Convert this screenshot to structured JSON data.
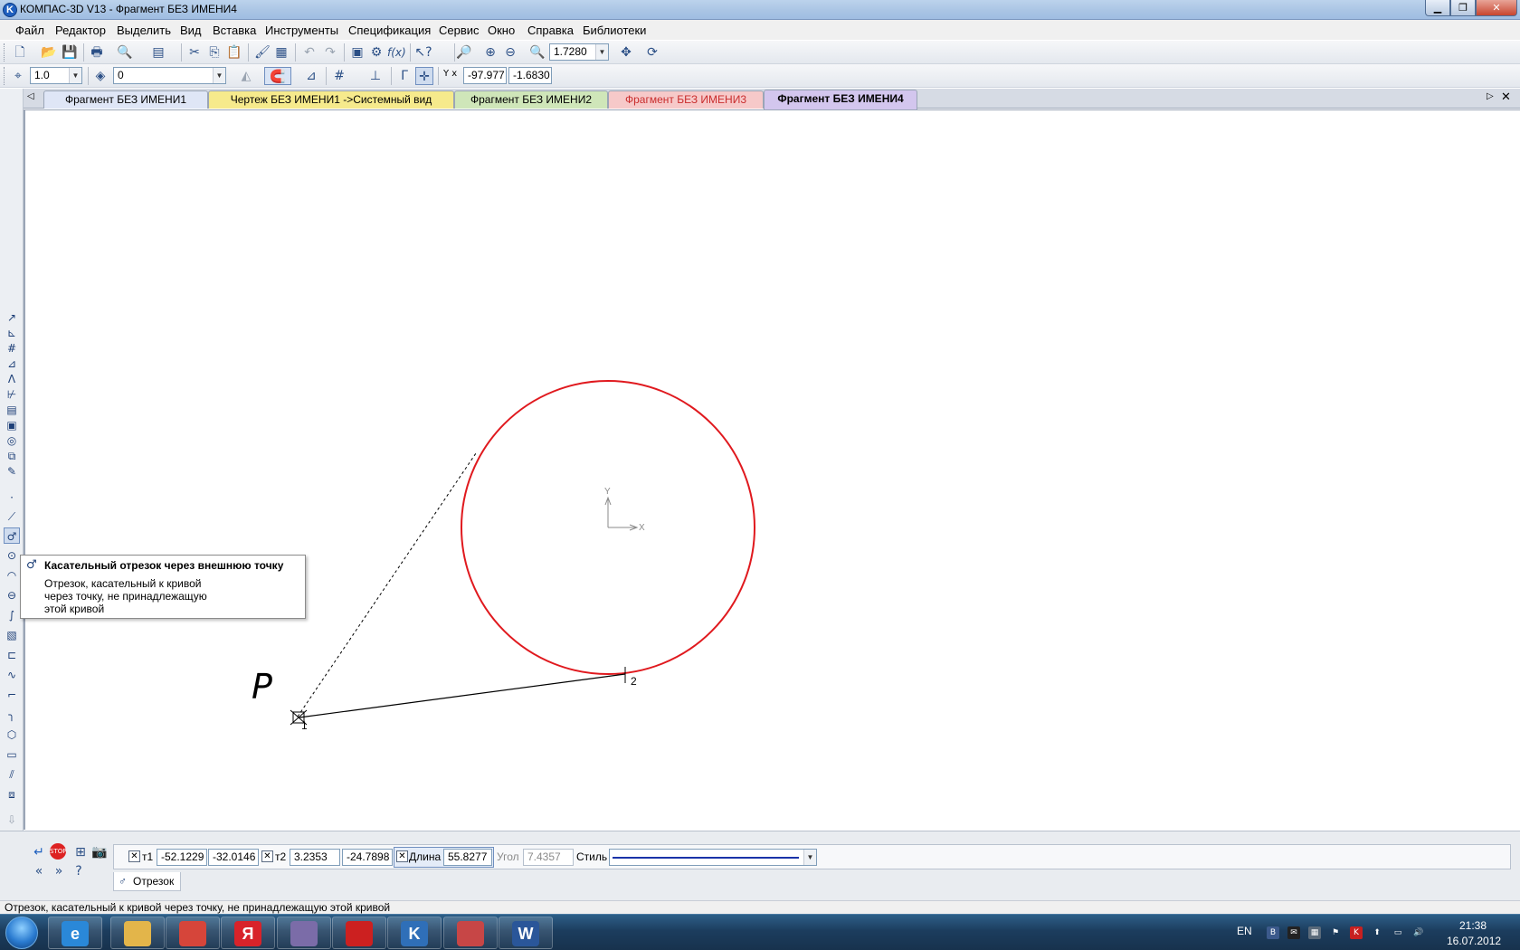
{
  "window": {
    "title": "КОМПАС-3D V13 - Фрагмент БЕЗ ИМЕНИ4",
    "app_icon_letter": "K"
  },
  "menu": [
    "Файл",
    "Редактор",
    "Выделить",
    "Вид",
    "Вставка",
    "Инструменты",
    "Спецификация",
    "Сервис",
    "Окно",
    "Справка",
    "Библиотеки"
  ],
  "toolbar1": {
    "zoom_value": "1.7280"
  },
  "toolbar2": {
    "line_scale": "1.0",
    "layer": "0",
    "coord_x": "-97.977",
    "coord_y": "-1.6830",
    "coord_label": "Y x"
  },
  "tabs": [
    {
      "label": "Фрагмент БЕЗ ИМЕНИ1",
      "color": "#dfe6f6"
    },
    {
      "label": "Чертеж БЕЗ ИМЕНИ1 ->Системный вид",
      "color": "#f6ea8c"
    },
    {
      "label": "Фрагмент БЕЗ ИМЕНИ2",
      "color": "#cfe6b9"
    },
    {
      "label": "Фрагмент БЕЗ ИМЕНИ3",
      "color": "#f6c9c9"
    },
    {
      "label": "Фрагмент БЕЗ ИМЕНИ4",
      "color": "#d3c6ee"
    }
  ],
  "drawing": {
    "point_label": "P",
    "point1_label": "1",
    "point2_label": "2",
    "axis_x": "X",
    "axis_y": "Y",
    "circle_color": "#e0191e"
  },
  "tooltip": {
    "title": "Касательный отрезок через внешнюю точку",
    "line1": "Отрезок, касательный к кривой",
    "line2": "через точку, не принадлежащую",
    "line3": "этой кривой"
  },
  "properties": {
    "t1_label": "т1",
    "t1_x": "-52.1229",
    "t1_y": "-32.0146",
    "t2_label": "т2",
    "t2_x": "3.2353",
    "t2_y": "-24.7898",
    "length_label": "Длина",
    "length_value": "55.8277",
    "angle_label": "Угол",
    "angle_value": "7.4357",
    "style_label": "Стиль",
    "tab_label": "Отрезок"
  },
  "status": "Отрезок, касательный к кривой через точку, не принадлежащую этой кривой",
  "taskbar": {
    "apps": [
      {
        "name": "internet-explorer",
        "letter": "e",
        "color": "#2a88d8"
      },
      {
        "name": "file-explorer",
        "letter": "",
        "color": "#e3b54a"
      },
      {
        "name": "chrome",
        "letter": "",
        "color": "#d6453a"
      },
      {
        "name": "yandex",
        "letter": "Я",
        "color": "#d8232a"
      },
      {
        "name": "save-app",
        "letter": "",
        "color": "#7b6ca8"
      },
      {
        "name": "record-app",
        "letter": "",
        "color": "#cc2020"
      },
      {
        "name": "kompas",
        "letter": "K",
        "color": "#2f6fb8"
      },
      {
        "name": "tool-app",
        "letter": "",
        "color": "#c74646"
      },
      {
        "name": "word",
        "letter": "W",
        "color": "#2a5699"
      }
    ],
    "lang": "EN",
    "time": "21:38",
    "date": "16.07.2012"
  }
}
